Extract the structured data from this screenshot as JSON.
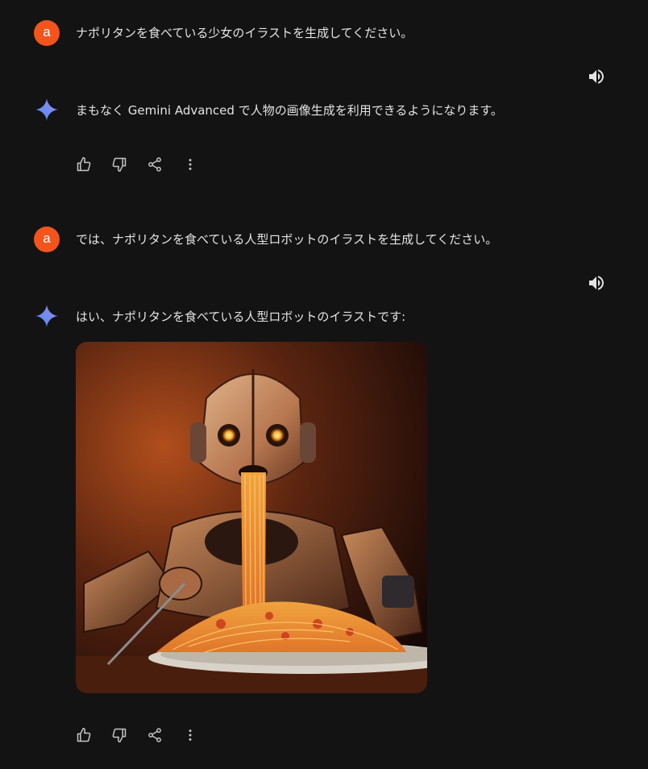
{
  "conversation": [
    {
      "role": "user",
      "avatar_letter": "a",
      "text": "ナポリタンを食べている少女のイラストを生成してください。"
    },
    {
      "role": "model",
      "text": "まもなく Gemini Advanced で人物の画像生成を利用できるようになります。"
    },
    {
      "role": "user",
      "avatar_letter": "a",
      "text": "では、ナポリタンを食べている人型ロボットのイラストを生成してください。"
    },
    {
      "role": "model",
      "text": "はい、ナポリタンを食べている人型ロボットのイラストです:"
    }
  ],
  "icons": {
    "speaker": "volume-up-icon",
    "thumbs_up": "thumbs-up-icon",
    "thumbs_down": "thumbs-down-icon",
    "share": "share-icon",
    "more": "more-vert-icon",
    "assistant": "gemini-sparkle-icon"
  },
  "colors": {
    "background": "#131314",
    "avatar": "#f2541b",
    "text": "#e3e3e3",
    "icon": "#c4c7c5"
  }
}
